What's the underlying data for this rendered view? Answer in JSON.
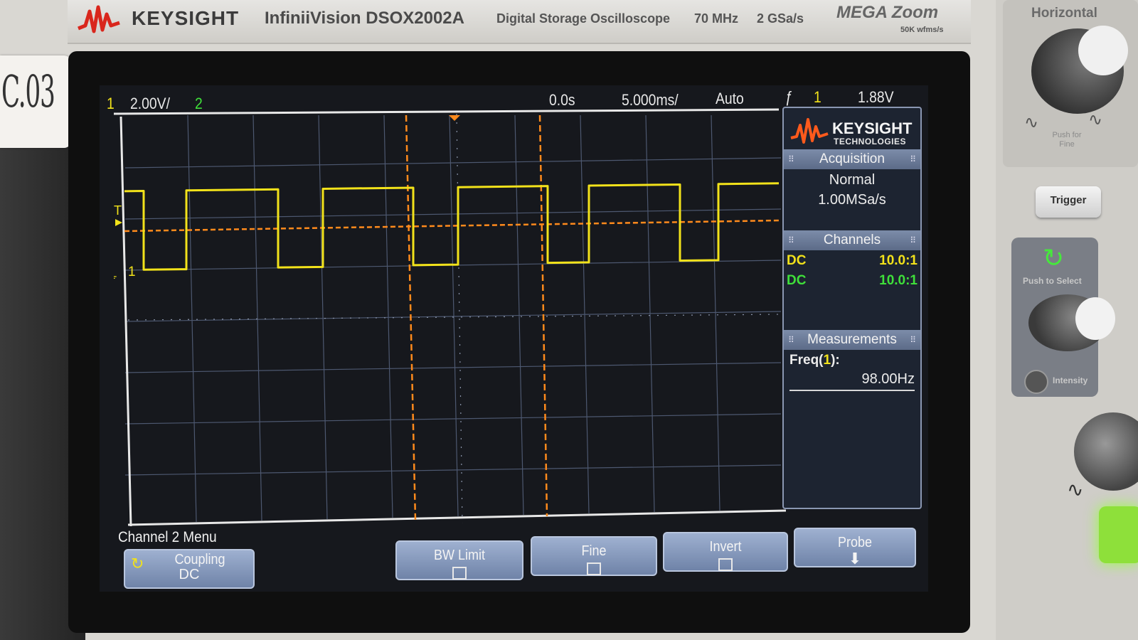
{
  "header": {
    "brand": "KEYSIGHT",
    "model": "InfiniiVision DSOX2002A",
    "description": "Digital Storage Oscilloscope",
    "bandwidth": "70 MHz",
    "sample_rate": "2 GSa/s",
    "megazoom": "MEGA Zoom",
    "megazoom_sub": "50K wfms/s"
  },
  "sticker_text": "C.03",
  "status": {
    "ch1_num": "1",
    "ch1_scale": "2.00V/",
    "ch2_num": "2",
    "time_delay": "0.0s",
    "time_scale": "5.000ms/",
    "trigger_mode": "Auto",
    "trigger_slope": "ƒ",
    "trigger_source": "1",
    "trigger_level": "1.88V"
  },
  "panel": {
    "logo_line1": "KEYSIGHT",
    "logo_line2": "TECHNOLOGIES",
    "acquisition_header": "Acquisition",
    "acquisition_mode": "Normal",
    "acquisition_rate": "1.00MSa/s",
    "channels_header": "Channels",
    "channels": [
      {
        "coupling": "DC",
        "probe": "10.0:1",
        "color": "#f2e21a"
      },
      {
        "coupling": "DC",
        "probe": "10.0:1",
        "color": "#3fe03a"
      }
    ],
    "measurements_header": "Measurements",
    "measurement_label": "Freq(",
    "measurement_source": "1",
    "measurement_label_end": "):",
    "measurement_value": "98.00Hz"
  },
  "softkeys": {
    "menu_title": "Channel 2 Menu",
    "coupling_label": "Coupling",
    "coupling_value": "DC",
    "bw_limit": "BW Limit",
    "fine": "Fine",
    "invert": "Invert",
    "probe": "Probe"
  },
  "controls": {
    "horizontal_title": "Horizontal",
    "push_fine": "Push for Fine",
    "trigger_button": "Trigger",
    "push_select": "Push to Select",
    "intensity": "Intensity"
  },
  "markers": {
    "trigger_marker": "T",
    "ch1_ground": "1"
  },
  "colors": {
    "ch1": "#f2e21a",
    "ch2": "#3fe03a",
    "cursor": "#ff8a1c",
    "grid": "#54607a"
  },
  "waveform": {
    "channel": "1",
    "frequency_hz": 98.0,
    "high_level": "high",
    "low_level": "low"
  }
}
